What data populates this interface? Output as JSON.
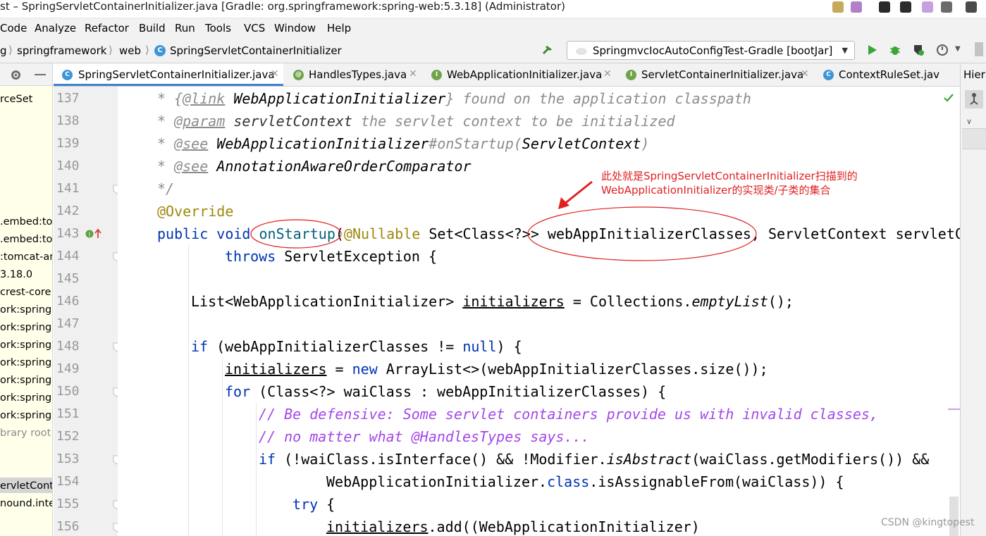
{
  "window": {
    "title": "st – SpringServletContainerInitializer.java [Gradle: org.springframework:spring-web:5.3.18] (Administrator)"
  },
  "menu": {
    "items": [
      "Code",
      "Analyze",
      "Refactor",
      "Build",
      "Run",
      "Tools",
      "VCS",
      "Window",
      "Help"
    ]
  },
  "breadcrumb": {
    "items": [
      "g",
      "springframework",
      "web",
      "SpringServletContainerInitializer"
    ]
  },
  "run_config": {
    "label": "SpringmvcIocAutoConfigTest-Gradle [bootJar]"
  },
  "left_panel": {
    "header_label": "",
    "items": [
      {
        "text": "rceSet",
        "dim": false
      },
      {
        "text": ".embed:to",
        "dim": false
      },
      {
        "text": ".embed:to",
        "dim": false
      },
      {
        "text": ":tomcat-ar",
        "dim": false
      },
      {
        "text": "3.18.0",
        "dim": false
      },
      {
        "text": "crest-core:",
        "dim": false
      },
      {
        "text": "ork:spring-a",
        "dim": false
      },
      {
        "text": "ork:spring-b",
        "dim": false
      },
      {
        "text": "ork:spring-c",
        "dim": false
      },
      {
        "text": "ork:spring-c",
        "dim": false
      },
      {
        "text": "ork:spring-e",
        "dim": false
      },
      {
        "text": "ork:spring-j",
        "dim": false
      },
      {
        "text": "ork:spring-w",
        "dim": false
      },
      {
        "text": "brary root",
        "dim": true
      },
      {
        "text": "ervletCont",
        "dim": false
      },
      {
        "text": "nound.inte",
        "dim": false
      }
    ]
  },
  "tabs": [
    {
      "label": "SpringServletContainerInitializer.java",
      "icon": "C",
      "active": true
    },
    {
      "label": "HandlesTypes.java",
      "icon": "@",
      "active": false
    },
    {
      "label": "WebApplicationInitializer.java",
      "icon": "I",
      "active": false
    },
    {
      "label": "ServletContainerInitializer.java",
      "icon": "I",
      "active": false
    },
    {
      "label": "ContextRuleSet.jav",
      "icon": "C",
      "active": false
    }
  ],
  "right_panel": {
    "label": "Hier"
  },
  "editor": {
    "line_numbers": [
      "137",
      "138",
      "139",
      "140",
      "141",
      "142",
      "143",
      "144",
      "145",
      "146",
      "147",
      "148",
      "149",
      "150",
      "151",
      "152",
      "153",
      "154",
      "155",
      "156"
    ]
  },
  "annotation": {
    "line1": "此处就是SpringServletContainerInitializer扫描到的",
    "line2": "WebApplicationInitializer的实现类/子类的集合"
  },
  "watermark": "CSDN @kingtopest",
  "colors": {
    "keyword": "#0033b3",
    "annotation": "#9e880d",
    "javadoc": "#8c8c8c",
    "line_comment": "#a347e8",
    "callout": "#e02020",
    "active_tab": "#4083c9"
  }
}
